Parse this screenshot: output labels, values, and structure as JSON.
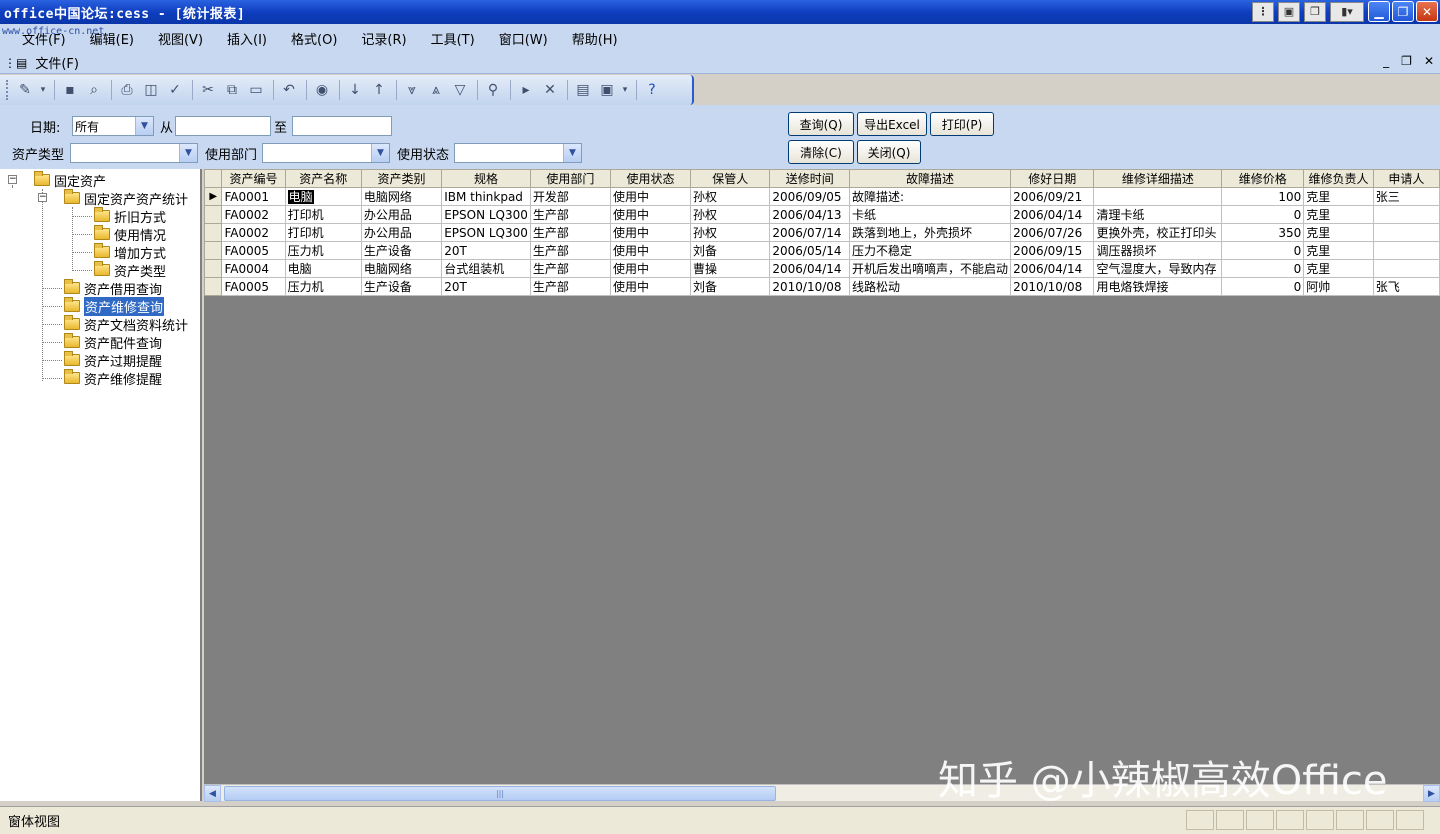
{
  "window": {
    "title": "office中国论坛:cess - [统计报表]",
    "watermark_url": "www.office-cn.net"
  },
  "menu": [
    "文件(F)",
    "编辑(E)",
    "视图(V)",
    "插入(I)",
    "格式(O)",
    "记录(R)",
    "工具(T)",
    "窗口(W)",
    "帮助(H)"
  ],
  "docbar": {
    "label": "文件(F)"
  },
  "filters": {
    "date_label": "日期:",
    "date_value": "所有",
    "from_label": "从",
    "to_label": "至",
    "asset_type_label": "资产类型",
    "dept_label": "使用部门",
    "status_label": "使用状态"
  },
  "buttons": {
    "query": "查询(Q)",
    "export": "导出Excel",
    "print": "打印(P)",
    "clear": "清除(C)",
    "close": "关闭(Q)"
  },
  "tree": {
    "root": "固定资产",
    "stats": "固定资产资产统计",
    "children": [
      "折旧方式",
      "使用情况",
      "增加方式",
      "资产类型"
    ],
    "items": [
      "资产借用查询",
      "资产维修查询",
      "资产文档资料统计",
      "资产配件查询",
      "资产过期提醒",
      "资产维修提醒"
    ]
  },
  "table": {
    "columns": [
      "资产编号",
      "资产名称",
      "资产类别",
      "规格",
      "使用部门",
      "使用状态",
      "保管人",
      "送修时间",
      "故障描述",
      "修好日期",
      "维修详细描述",
      "维修价格",
      "维修负责人",
      "申请人"
    ],
    "rows": [
      [
        "FA0001",
        "电脑",
        "电脑网络",
        "IBM thinkpad",
        "开发部",
        "使用中",
        "孙权",
        "2006/09/05",
        "故障描述:",
        "2006/09/21",
        "",
        "100",
        "克里",
        "张三"
      ],
      [
        "FA0002",
        "打印机",
        "办公用品",
        "EPSON LQ300",
        "生产部",
        "使用中",
        "孙权",
        "2006/04/13",
        "卡纸",
        "2006/04/14",
        "清理卡纸",
        "0",
        "克里",
        ""
      ],
      [
        "FA0002",
        "打印机",
        "办公用品",
        "EPSON LQ300",
        "生产部",
        "使用中",
        "孙权",
        "2006/07/14",
        "跌落到地上，外壳损坏",
        "2006/07/26",
        "更换外壳，校正打印头",
        "350",
        "克里",
        ""
      ],
      [
        "FA0005",
        "压力机",
        "生产设备",
        "20T",
        "生产部",
        "使用中",
        "刘备",
        "2006/05/14",
        "压力不稳定",
        "2006/09/15",
        "调压器损坏",
        "0",
        "克里",
        ""
      ],
      [
        "FA0004",
        "电脑",
        "电脑网络",
        "台式组装机",
        "生产部",
        "使用中",
        "曹操",
        "2006/04/14",
        "开机后发出嘀嘀声，不能启动",
        "2006/04/14",
        "空气湿度大，导致内存",
        "0",
        "克里",
        ""
      ],
      [
        "FA0005",
        "压力机",
        "生产设备",
        "20T",
        "生产部",
        "使用中",
        "刘备",
        "2010/10/08",
        "线路松动",
        "2010/10/08",
        "用电烙铁焊接",
        "0",
        "阿帅",
        "张飞"
      ]
    ]
  },
  "status": {
    "text": "窗体视图"
  },
  "overlay_watermark": "知乎 @小辣椒高效Office"
}
